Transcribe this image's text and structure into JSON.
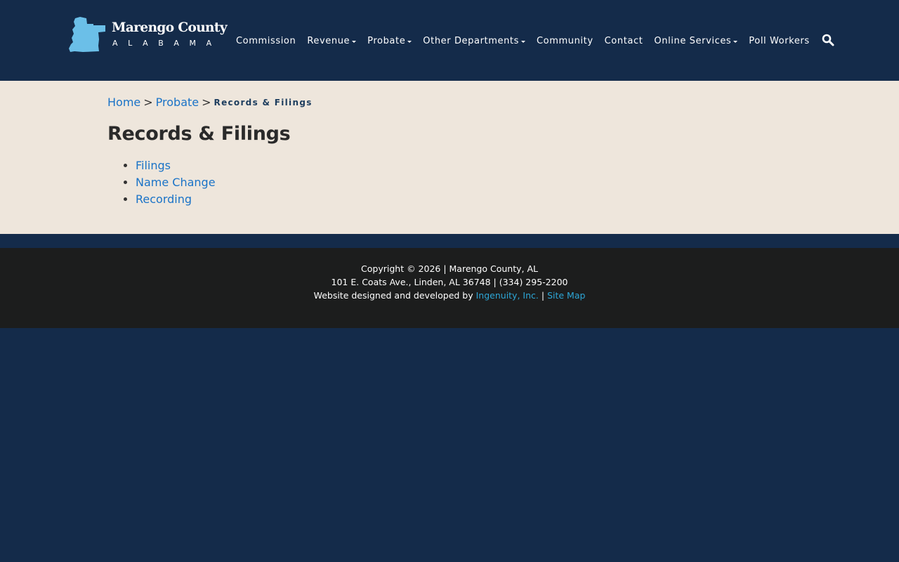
{
  "site": {
    "logo_name": "Marengo County",
    "logo_state": "ALABAMA",
    "logo_color": "#6bbfe8"
  },
  "nav": {
    "items": [
      {
        "label": "Commission",
        "dropdown": false
      },
      {
        "label": "Revenue",
        "dropdown": true
      },
      {
        "label": "Probate",
        "dropdown": true
      },
      {
        "label": "Other Departments",
        "dropdown": true
      },
      {
        "label": "Community",
        "dropdown": false
      },
      {
        "label": "Contact",
        "dropdown": false
      },
      {
        "label": "Online Services",
        "dropdown": true
      },
      {
        "label": "Poll Workers",
        "dropdown": false
      }
    ],
    "search_icon": "search-icon"
  },
  "breadcrumb": {
    "home": "Home",
    "sep1": ">",
    "probate": "Probate",
    "sep2": ">",
    "current": "Records & Filings"
  },
  "main": {
    "title": "Records & Filings",
    "links": [
      "Filings",
      "Name Change",
      "Recording"
    ]
  },
  "footer": {
    "copyright": "Copyright © 2026 | Marengo County, AL",
    "address": "101 E. Coats Ave., Linden, AL 36748 | (334) 295-2200",
    "credit_prefix": "Website designed and developed by",
    "credit_link": "Ingenuity, Inc.",
    "divider": "|",
    "sitemap": "Site Map"
  },
  "colors": {
    "header_bg": "#142b4a",
    "content_bg": "#eee6dc",
    "footer_bg": "#1c1d1d",
    "link": "#1a73c7",
    "footer_link": "#2da6d6"
  }
}
